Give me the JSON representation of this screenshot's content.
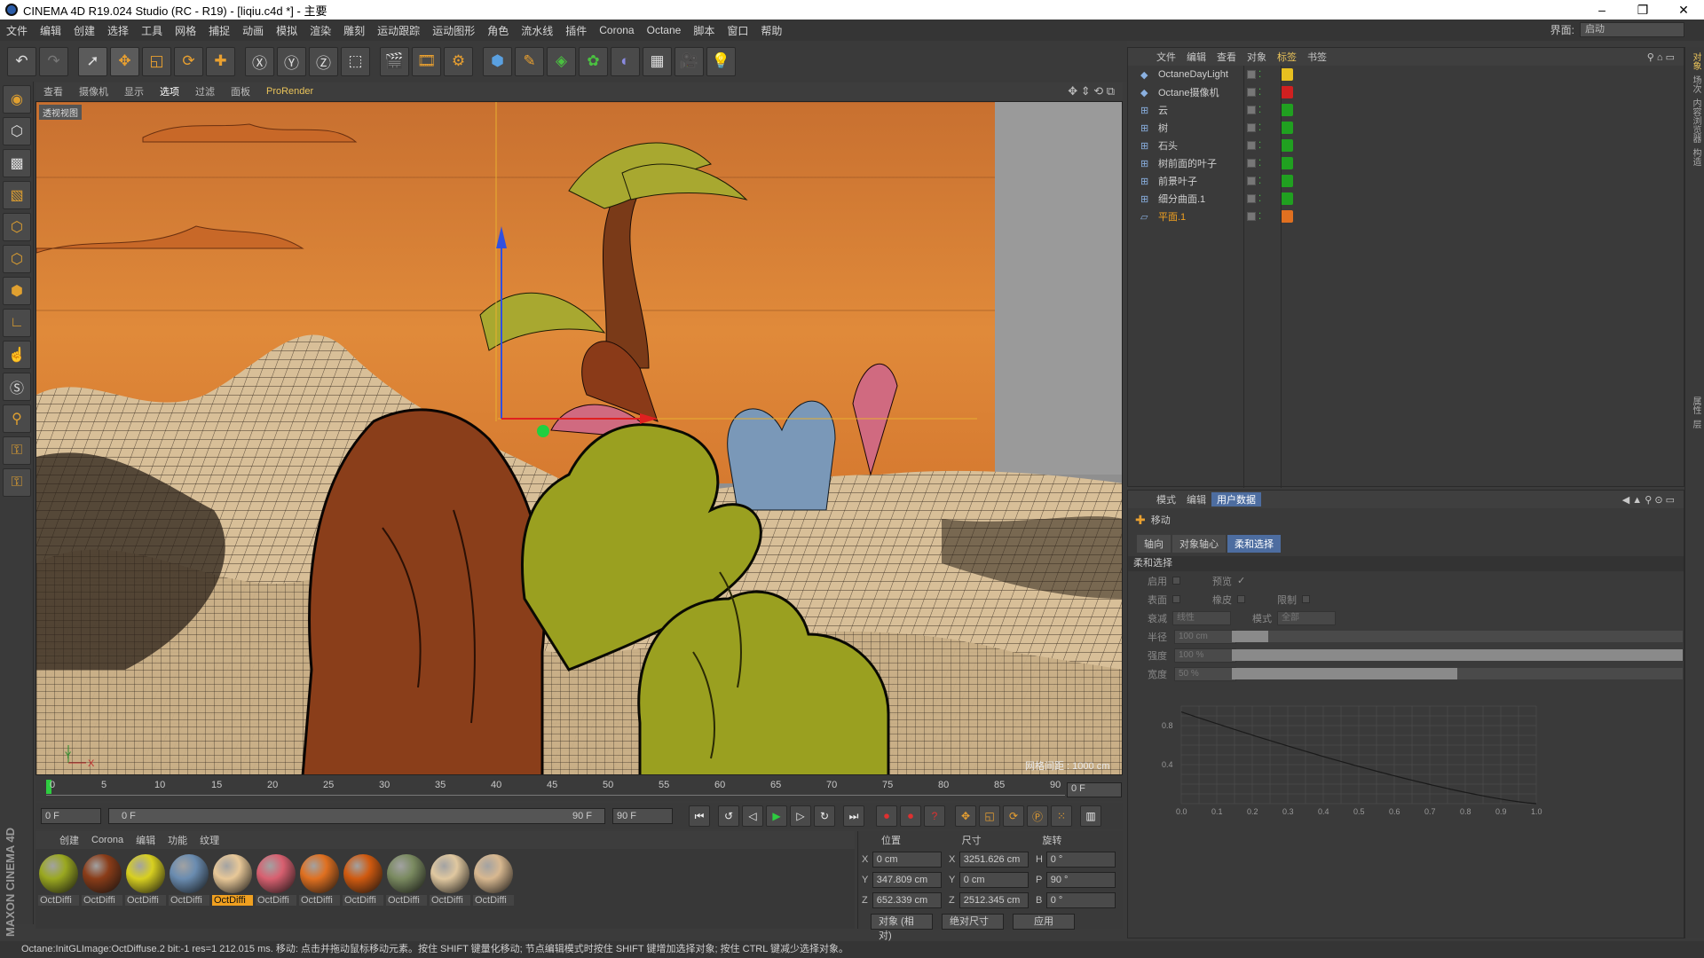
{
  "window": {
    "title": "CINEMA 4D R19.024 Studio (RC - R19) - [liqiu.c4d *] - 主要",
    "min": "–",
    "max": "❐",
    "close": "✕"
  },
  "menu": {
    "items": [
      "文件",
      "编辑",
      "创建",
      "选择",
      "工具",
      "网格",
      "捕捉",
      "动画",
      "模拟",
      "渲染",
      "雕刻",
      "运动跟踪",
      "运动图形",
      "角色",
      "流水线",
      "插件",
      "Corona",
      "Octane",
      "脚本",
      "窗口",
      "帮助"
    ],
    "layout_label": "界面:",
    "layout_value": "启动"
  },
  "viewport": {
    "menu": [
      "查看",
      "摄像机",
      "显示",
      "选项",
      "过滤",
      "面板",
      "ProRender"
    ],
    "label": "透视视图",
    "grid_info": "网格间距 : 1000 cm"
  },
  "timeline": {
    "ticks": [
      "0",
      "5",
      "10",
      "15",
      "20",
      "25",
      "30",
      "35",
      "40",
      "45",
      "50",
      "55",
      "60",
      "65",
      "70",
      "75",
      "80",
      "85",
      "90"
    ],
    "current_frame": "0 F",
    "start": "0 F",
    "range_start": "0 F",
    "range_end": "90 F",
    "end": "90 F"
  },
  "materials": {
    "menu": [
      "创建",
      "Corona",
      "编辑",
      "功能",
      "纹理"
    ],
    "items": [
      {
        "label": "OctDiffi",
        "color": "#9aa820",
        "active": false
      },
      {
        "label": "OctDiffi",
        "color": "#8a3c18",
        "active": false
      },
      {
        "label": "OctDiffi",
        "color": "#d8d020",
        "active": false
      },
      {
        "label": "OctDiffi",
        "color": "#6a8cb0",
        "active": false
      },
      {
        "label": "OctDiffi",
        "color": "#e8c898",
        "active": true
      },
      {
        "label": "OctDiffi",
        "color": "#d86070",
        "active": false
      },
      {
        "label": "OctDiffi",
        "color": "#e07020",
        "active": false
      },
      {
        "label": "OctDiffi",
        "color": "#d05a10",
        "active": false
      },
      {
        "label": "OctDiffi",
        "color": "#7a8a60",
        "active": false
      },
      {
        "label": "OctDiffi",
        "color": "#e0c8a0",
        "active": false
      },
      {
        "label": "OctDiffi",
        "color": "#d8b890",
        "active": false
      }
    ]
  },
  "coords": {
    "headers": [
      "位置",
      "尺寸",
      "旋转"
    ],
    "rows": [
      {
        "a1": "X",
        "v1": "0 cm",
        "a2": "X",
        "v2": "3251.626 cm",
        "a3": "H",
        "v3": "0 °"
      },
      {
        "a1": "Y",
        "v1": "347.809 cm",
        "a2": "Y",
        "v2": "0 cm",
        "a3": "P",
        "v3": "90 °"
      },
      {
        "a1": "Z",
        "v1": "652.339 cm",
        "a2": "Z",
        "v2": "2512.345 cm",
        "a3": "B",
        "v3": "0 °"
      }
    ],
    "mode": "对象 (相对)",
    "size_mode": "绝对尺寸",
    "apply": "应用"
  },
  "objects": {
    "menu": [
      "文件",
      "编辑",
      "查看",
      "对象",
      "标签",
      "书签"
    ],
    "items": [
      {
        "name": "OctaneDayLight",
        "selected": false,
        "tag": "#e8c020"
      },
      {
        "name": "Octane摄像机",
        "selected": false,
        "tag": "#d02020"
      },
      {
        "name": "云",
        "selected": false,
        "tag": "#20a020"
      },
      {
        "name": "树",
        "selected": false,
        "tag": "#20a020"
      },
      {
        "name": "石头",
        "selected": false,
        "tag": "#20a020"
      },
      {
        "name": "树前面的叶子",
        "selected": false,
        "tag": "#20a020"
      },
      {
        "name": "前景叶子",
        "selected": false,
        "tag": "#20a020"
      },
      {
        "name": "细分曲面.1",
        "selected": false,
        "tag": "#20a020"
      },
      {
        "name": "平面.1",
        "selected": true,
        "tag": "#e07020"
      }
    ]
  },
  "attributes": {
    "menu": [
      "模式",
      "编辑",
      "用户数据"
    ],
    "tool": "移动",
    "subtabs": [
      "轴向",
      "对象轴心",
      "柔和选择"
    ],
    "section": "柔和选择",
    "enable": "启用",
    "preview": "预览",
    "surface": "表面",
    "rubber": "橡皮",
    "restrict": "限制",
    "falloff_label": "衰减",
    "falloff_value": "线性",
    "mode_label": "模式",
    "mode_value": "全部",
    "radius_label": "半径",
    "radius_value": "100 cm",
    "radius_fill": 0.08,
    "strength_label": "强度",
    "strength_value": "100 %",
    "strength_fill": 1.0,
    "width_label": "宽度",
    "width_value": "50 %",
    "width_fill": 0.5,
    "graph_y": [
      "0.8",
      "0.4"
    ],
    "graph_x": [
      "0.0",
      "0.1",
      "0.2",
      "0.3",
      "0.4",
      "0.5",
      "0.6",
      "0.7",
      "0.8",
      "0.9",
      "1.0"
    ]
  },
  "right_strip": [
    "对象",
    "场次",
    "内容浏览器",
    "构造",
    "属性",
    "层"
  ],
  "status": "Octane:InitGLImage:OctDiffuse.2  bit:-1 res=1  212.015 ms.       移动: 点击并拖动鼠标移动元素。按住 SHIFT 键量化移动; 节点编辑模式时按住 SHIFT 键增加选择对象; 按住 CTRL 键减少选择对象。"
}
